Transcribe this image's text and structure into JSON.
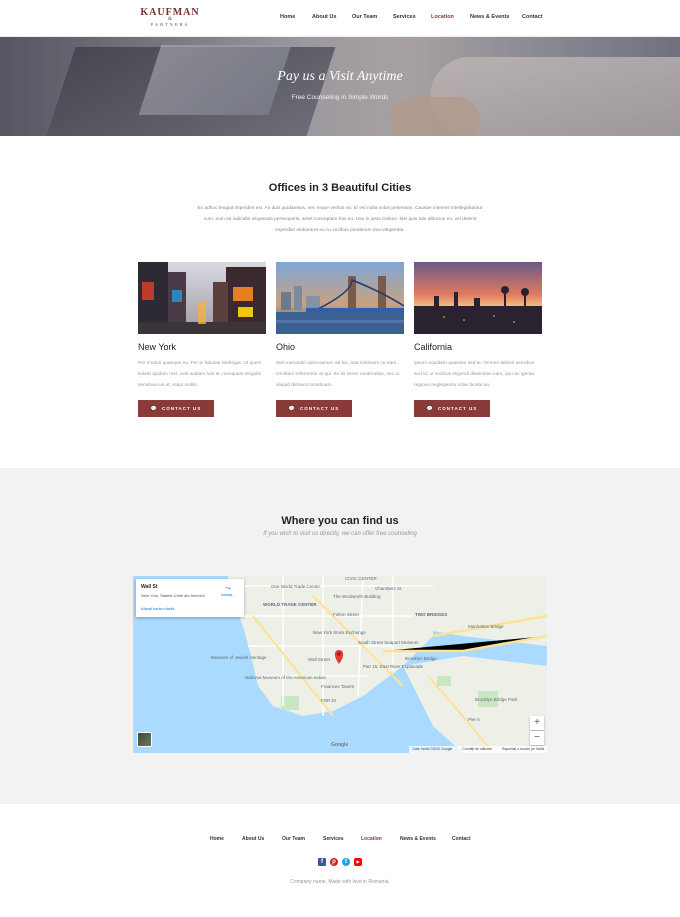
{
  "brand": {
    "name": "KAUFMAN",
    "amp": "&",
    "sub": "PARTNERS",
    "color": "#8b3a3a"
  },
  "nav": [
    {
      "label": "Home",
      "active": false
    },
    {
      "label": "About Us",
      "active": false
    },
    {
      "label": "Our Team",
      "active": false
    },
    {
      "label": "Services",
      "active": false
    },
    {
      "label": "Location",
      "active": true
    },
    {
      "label": "News & Events",
      "active": false
    },
    {
      "label": "Contact",
      "active": false
    }
  ],
  "hero": {
    "title": "Pay us a Visit Anytime",
    "subtitle": "Free Counseling in Simple Words"
  },
  "offices": {
    "title": "Offices in 3 Beautiful Cities",
    "intro": "Ex adhuc feugiat imperdiet est. An duis quidamsus, nec reque veritus no. Ei est nulla nobis petentium. Causae intermis intellegebantur cum, eum ea iudicabit vituperata persequeris, amet conceptam has eu. Usu in justo civibus. Mei quis tale albucius eu, vel delenit imperdiet elaboraret eu cu vocibus ponderum duo vituperata.",
    "cards": [
      {
        "city": "New York",
        "text": "Per modus quaeque eu. Per te fabulas intellegat. Ut quem soleat quidam mel, velit audiam has at, numquam singulis sensibus ius ut. Atqui mollis.",
        "button": "CONTACT US",
        "icon": "chat-icon"
      },
      {
        "city": "Ohio",
        "text": "Stet menandri adversarium ad his, tota minimum cu eam. Omittam referrentur at qui. Ex sit lorem moderatius, nec ut aliquid detraxit constituam.",
        "button": "CONTACT US",
        "icon": "chat-icon"
      },
      {
        "city": "California",
        "text": "Ipsum equidem quaestio sed te. Omnes delenit sensibus sed id, ut vocibus eligendi dissentias eam, quo an ignota regione neglegentur vitae facete an.",
        "button": "CONTACT US",
        "icon": "chat-icon"
      }
    ]
  },
  "location": {
    "title": "Where you can find us",
    "subtitle": "If you wish to visit us directly, we can offer free counseling",
    "map": {
      "place_name": "Wall St",
      "place_address": "New York, Statele Unite ale Americii",
      "larger_map_link": "Afișaţi harta mărită",
      "directions_label": "Indicaţi...",
      "zoom_in": "+",
      "zoom_out": "−",
      "google": "Google",
      "attribution": [
        "Date hartă ©2020 Google",
        "Condiţii de utilizare",
        "Raportaţi o eroare pe hartă"
      ],
      "labels": [
        "CIVIC CENTER",
        "One World Trade Center",
        "Chambers St",
        "The Woolworth Building",
        "TWO BRIDGES",
        "WORLD TRADE CENTER",
        "Fulton Street",
        "Manhattan Bridge",
        "New York Stock Exchange",
        "South Street Seaport Museum",
        "Wall Street",
        "Pier 15, East River Esplanade",
        "Museum of Jewish Heritage",
        "Brooklyn Bridge",
        "National Museum of the American Indian",
        "Fraunces Tavern",
        "Brooklyn Bridge Park",
        "FDR Dr",
        "Pier 6"
      ]
    }
  },
  "footer": {
    "nav": [
      {
        "label": "Home",
        "active": false
      },
      {
        "label": "About Us",
        "active": false
      },
      {
        "label": "Our Team",
        "active": false
      },
      {
        "label": "Services",
        "active": false
      },
      {
        "label": "Location",
        "active": true
      },
      {
        "label": "News & Events",
        "active": false
      },
      {
        "label": "Contact",
        "active": false
      }
    ],
    "social": [
      {
        "name": "facebook-icon",
        "glyph": "f",
        "color": "#3b5998"
      },
      {
        "name": "pinterest-icon",
        "glyph": "p",
        "color": "#cb2027"
      },
      {
        "name": "twitter-icon",
        "glyph": "t",
        "color": "#1da1f2"
      },
      {
        "name": "youtube-icon",
        "glyph": "▶",
        "color": "#ff0000"
      }
    ],
    "copyright": "Company name. Made with love in Romania."
  }
}
